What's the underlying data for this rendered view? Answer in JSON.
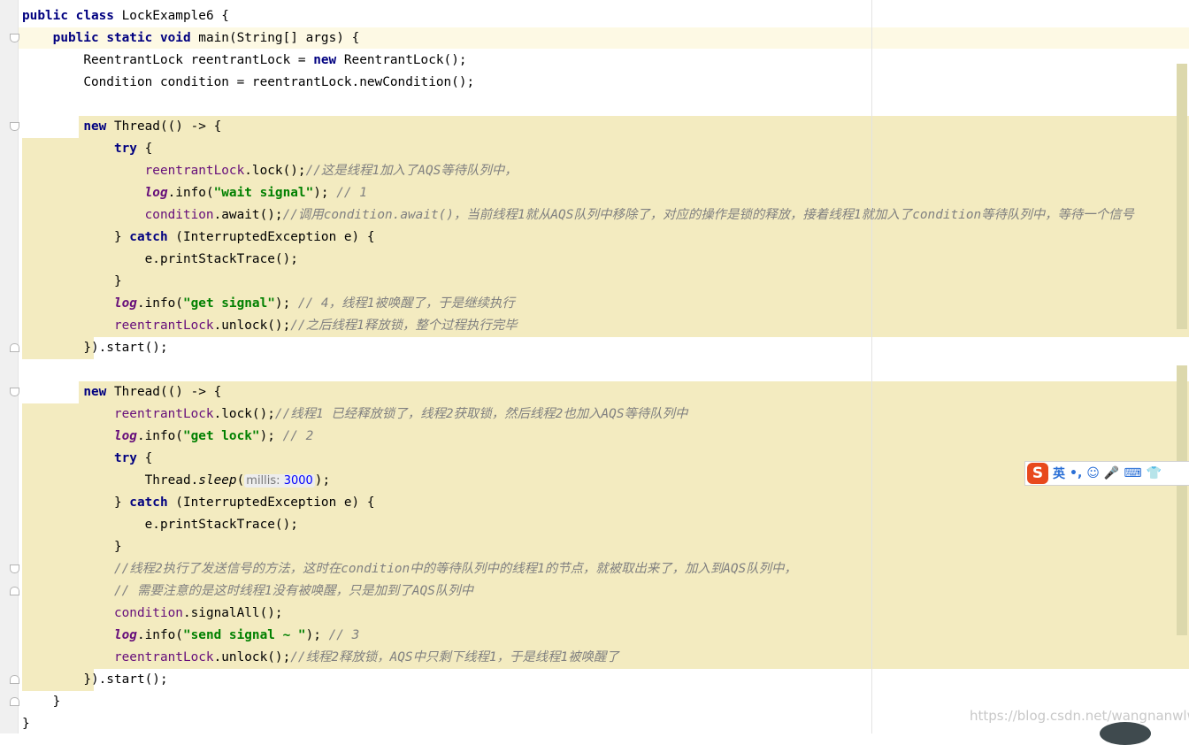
{
  "code": {
    "l1": {
      "a": "public",
      "b": " ",
      "c": "class",
      "d": " LockExample6 {"
    },
    "l2": {
      "a": "public",
      "b": " ",
      "c": "static",
      "d": " ",
      "e": "void",
      "f": " main(String[] args) {"
    },
    "l3": {
      "a": "ReentrantLock reentrantLock = ",
      "b": "new",
      "c": " ReentrantLock();"
    },
    "l4": {
      "a": "Condition condition = reentrantLock.newCondition();"
    },
    "l6": {
      "a": "new",
      "b": " Thread(() -> {"
    },
    "l7": {
      "a": "try",
      "b": " {"
    },
    "l8": {
      "a": "reentrantLock",
      "b": ".lock();",
      "c": "//这是线程1加入了AQS等待队列中，"
    },
    "l9": {
      "a": "log",
      "b": ".info(",
      "c": "\"wait signal\"",
      "d": "); ",
      "e": "// 1"
    },
    "l10": {
      "a": "condition",
      "b": ".await();",
      "c": "//调用condition.await()，当前线程1就从AQS队列中移除了，对应的操作是锁的释放，接着线程1就加入了condition等待队列中，等待一个信号"
    },
    "l11": {
      "a": "} ",
      "b": "catch",
      "c": " (InterruptedException e) {"
    },
    "l12": {
      "a": "e.printStackTrace();"
    },
    "l13": {
      "a": "}"
    },
    "l14": {
      "a": "log",
      "b": ".info(",
      "c": "\"get signal\"",
      "d": "); ",
      "e": "// 4，线程1被唤醒了，于是继续执行"
    },
    "l15": {
      "a": "reentrantLock",
      "b": ".unlock();",
      "c": "//之后线程1释放锁，整个过程执行完毕"
    },
    "l16": {
      "a": "}).start();"
    },
    "l18": {
      "a": "new",
      "b": " Thread(() -> {"
    },
    "l19": {
      "a": "reentrantLock",
      "b": ".lock();",
      "c": "//线程1 已经释放锁了，线程2获取锁，然后线程2也加入AQS等待队列中"
    },
    "l20": {
      "a": "log",
      "b": ".info(",
      "c": "\"get lock\"",
      "d": "); ",
      "e": "// 2"
    },
    "l21": {
      "a": "try",
      "b": " {"
    },
    "l22": {
      "a": "Thread.",
      "b": "sleep",
      "c": "(",
      "d": "millis:",
      "e": "3000",
      "f": ");"
    },
    "l23": {
      "a": "} ",
      "b": "catch",
      "c": " (InterruptedException e) {"
    },
    "l24": {
      "a": "e.printStackTrace();"
    },
    "l25": {
      "a": "}"
    },
    "l26": {
      "a": "//线程2执行了发送信号的方法，这时在condition中的等待队列中的线程1的节点，就被取出来了，加入到AQS队列中，"
    },
    "l27": {
      "a": "// 需要注意的是这时线程1没有被唤醒，只是加到了AQS队列中"
    },
    "l28": {
      "a": "condition",
      "b": ".signalAll();"
    },
    "l29": {
      "a": "log",
      "b": ".info(",
      "c": "\"send signal ~ \"",
      "d": "); ",
      "e": "// 3"
    },
    "l30": {
      "a": "reentrantLock",
      "b": ".unlock();",
      "c": "//线程2释放锁，AQS中只剩下线程1，于是线程1被唤醒了"
    },
    "l31": {
      "a": "}).start();"
    },
    "l32": {
      "a": "}"
    },
    "l33": {
      "a": "}"
    }
  },
  "ime": {
    "logo": "S",
    "lang": "英",
    "punct": "•,",
    "emoji": "☺",
    "mic": "🎤",
    "keyboard": "⌨",
    "skin": "👕"
  },
  "watermark": "https://blog.csdn.net/wangnanwlw",
  "colors": {
    "keyword": "#000080",
    "field": "#660e7a",
    "string": "#008000",
    "comment": "#808080",
    "highlight": "#f3ebc0"
  }
}
